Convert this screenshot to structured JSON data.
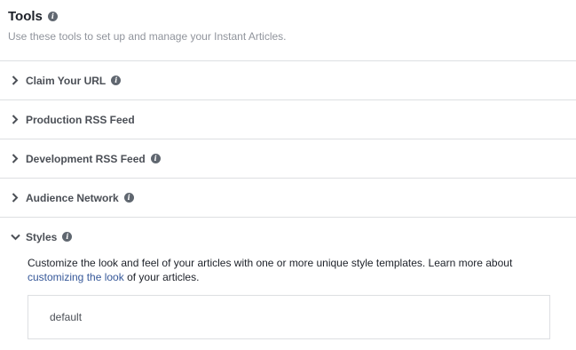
{
  "header": {
    "title": "Tools",
    "subtitle": "Use these tools to set up and manage your Instant Articles."
  },
  "sections": [
    {
      "label": "Claim Your URL",
      "expanded": false,
      "info": true
    },
    {
      "label": "Production RSS Feed",
      "expanded": false,
      "info": false
    },
    {
      "label": "Development RSS Feed",
      "expanded": false,
      "info": true
    },
    {
      "label": "Audience Network",
      "expanded": false,
      "info": true
    },
    {
      "label": "Styles",
      "expanded": true,
      "info": true
    }
  ],
  "styles_panel": {
    "description_before": "Customize the look and feel of your articles with one or more unique style templates. Learn more about ",
    "link_text": "customizing the look",
    "description_after": " of your articles.",
    "templates": [
      "default"
    ]
  },
  "icons": {
    "info": "info-icon",
    "collapsed": "chevron-right-icon",
    "expanded": "chevron-down-icon"
  },
  "colors": {
    "link": "#365899",
    "divider": "#dddfe2",
    "muted_text": "#90949c"
  }
}
